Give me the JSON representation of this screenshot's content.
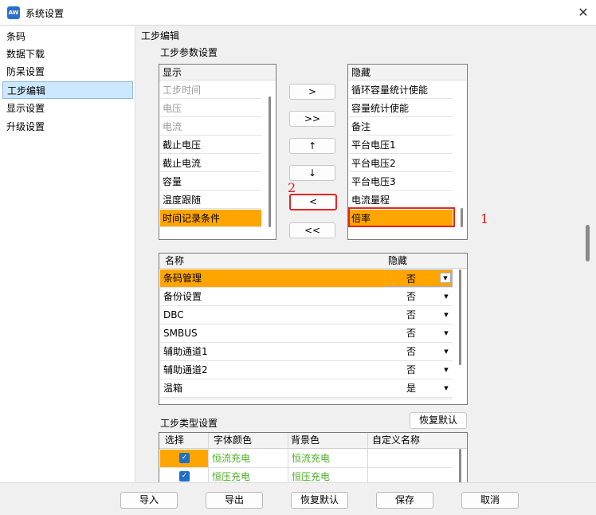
{
  "window": {
    "title": "系统设置",
    "icon_text": "AW",
    "close_glyph": "✕"
  },
  "nav": {
    "items": [
      "条码",
      "数据下载",
      "防呆设置",
      "工步编辑",
      "显示设置",
      "升级设置"
    ],
    "selected_index": 3
  },
  "section": {
    "title": "工步编辑",
    "params_title": "工步参数设置",
    "step_type_title": "工步类型设置"
  },
  "show_list": {
    "header": "显示",
    "items": [
      {
        "label": "工步时间",
        "state": "disabled"
      },
      {
        "label": "电压",
        "state": "disabled"
      },
      {
        "label": "电流",
        "state": "disabled"
      },
      {
        "label": "截止电压",
        "state": "normal"
      },
      {
        "label": "截止电流",
        "state": "normal"
      },
      {
        "label": "容量",
        "state": "normal"
      },
      {
        "label": "温度跟随",
        "state": "normal"
      },
      {
        "label": "时间记录条件",
        "state": "selected"
      }
    ]
  },
  "transfer_buttons": [
    ">",
    ">>",
    "↑",
    "↓",
    "<",
    "<<"
  ],
  "hide_list": {
    "header": "隐藏",
    "items": [
      "循环容量统计使能",
      "容量统计使能",
      "备注",
      "平台电压1",
      "平台电压2",
      "平台电压3",
      "电流量程",
      "倍率"
    ],
    "selected_index": 7
  },
  "annotations": {
    "one": "1",
    "two": "2"
  },
  "hide_grid": {
    "columns": [
      "名称",
      "隐藏"
    ],
    "rows": [
      {
        "name": "条码管理",
        "hidden": "否",
        "selected": true
      },
      {
        "name": "备份设置",
        "hidden": "否",
        "selected": false
      },
      {
        "name": "DBC",
        "hidden": "否",
        "selected": false
      },
      {
        "name": "SMBUS",
        "hidden": "否",
        "selected": false
      },
      {
        "name": "辅助通道1",
        "hidden": "否",
        "selected": false
      },
      {
        "name": "辅助通道2",
        "hidden": "否",
        "selected": false
      },
      {
        "name": "温箱",
        "hidden": "是",
        "selected": false
      }
    ],
    "arrow_glyph": "▼"
  },
  "restore_default_label": "恢复默认",
  "step_type_grid": {
    "columns": [
      "选择",
      "字体颜色",
      "背景色",
      "自定义名称"
    ],
    "rows": [
      {
        "checked": true,
        "font_color_label": "恒流充电",
        "bg_label": "恒流充电",
        "custom_name": "",
        "selected": true
      },
      {
        "checked": true,
        "font_color_label": "恒压充电",
        "bg_label": "恒压充电",
        "custom_name": "",
        "selected": false
      }
    ],
    "check_glyph": "✓",
    "text_color": "#4caf23"
  },
  "footer": {
    "buttons": [
      "导入",
      "导出",
      "恢复默认",
      "保存",
      "取消"
    ]
  },
  "colors": {
    "selection_orange": "#ffa500",
    "nav_selected_bg": "#cce8ff",
    "annotation_red": "#e52525"
  }
}
